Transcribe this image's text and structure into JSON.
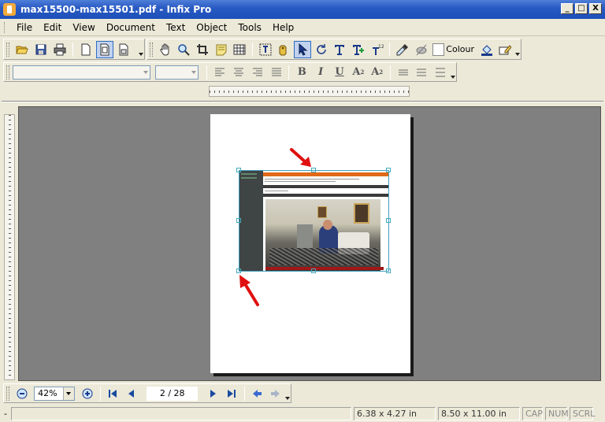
{
  "window": {
    "title": "max15500-max15501.pdf - Infix Pro",
    "min_label": "_",
    "max_label": "□",
    "close_label": "X"
  },
  "menu": {
    "items": [
      "File",
      "Edit",
      "View",
      "Document",
      "Text",
      "Object",
      "Tools",
      "Help"
    ]
  },
  "toolbar": {
    "colour_label": "Colour",
    "icons": [
      "open-icon",
      "save-icon",
      "print-icon",
      "single-page-icon",
      "fit-page-icon",
      "facing-page-icon",
      "hand-icon",
      "zoom-icon",
      "crop-icon",
      "note-icon",
      "grid-icon",
      "text-select-icon",
      "link-icon",
      "arrow-select-icon",
      "rotate-icon",
      "text-tool-icon",
      "add-text-icon",
      "numbering-icon",
      "eyedropper-icon",
      "eraser-icon",
      "colour-swatch",
      "fill-icon",
      "edit-icon"
    ]
  },
  "format_bar": {
    "font_value": "",
    "size_value": "",
    "bold": "B",
    "italic": "I",
    "underline": "U",
    "superscript": "A",
    "subscript": "A"
  },
  "navigation": {
    "zoom_value": "42%",
    "page_value": "2 / 28"
  },
  "status": {
    "left": "-",
    "object_size": "6.38 x 4.27 in",
    "page_size": "8.50 x 11.00 in",
    "cap": "CAP",
    "num": "NUM",
    "scrl": "SCRL"
  },
  "colors": {
    "title_bar": "#2a5bc4",
    "canvas": "#808080",
    "annotation_arrow": "#e01010"
  }
}
